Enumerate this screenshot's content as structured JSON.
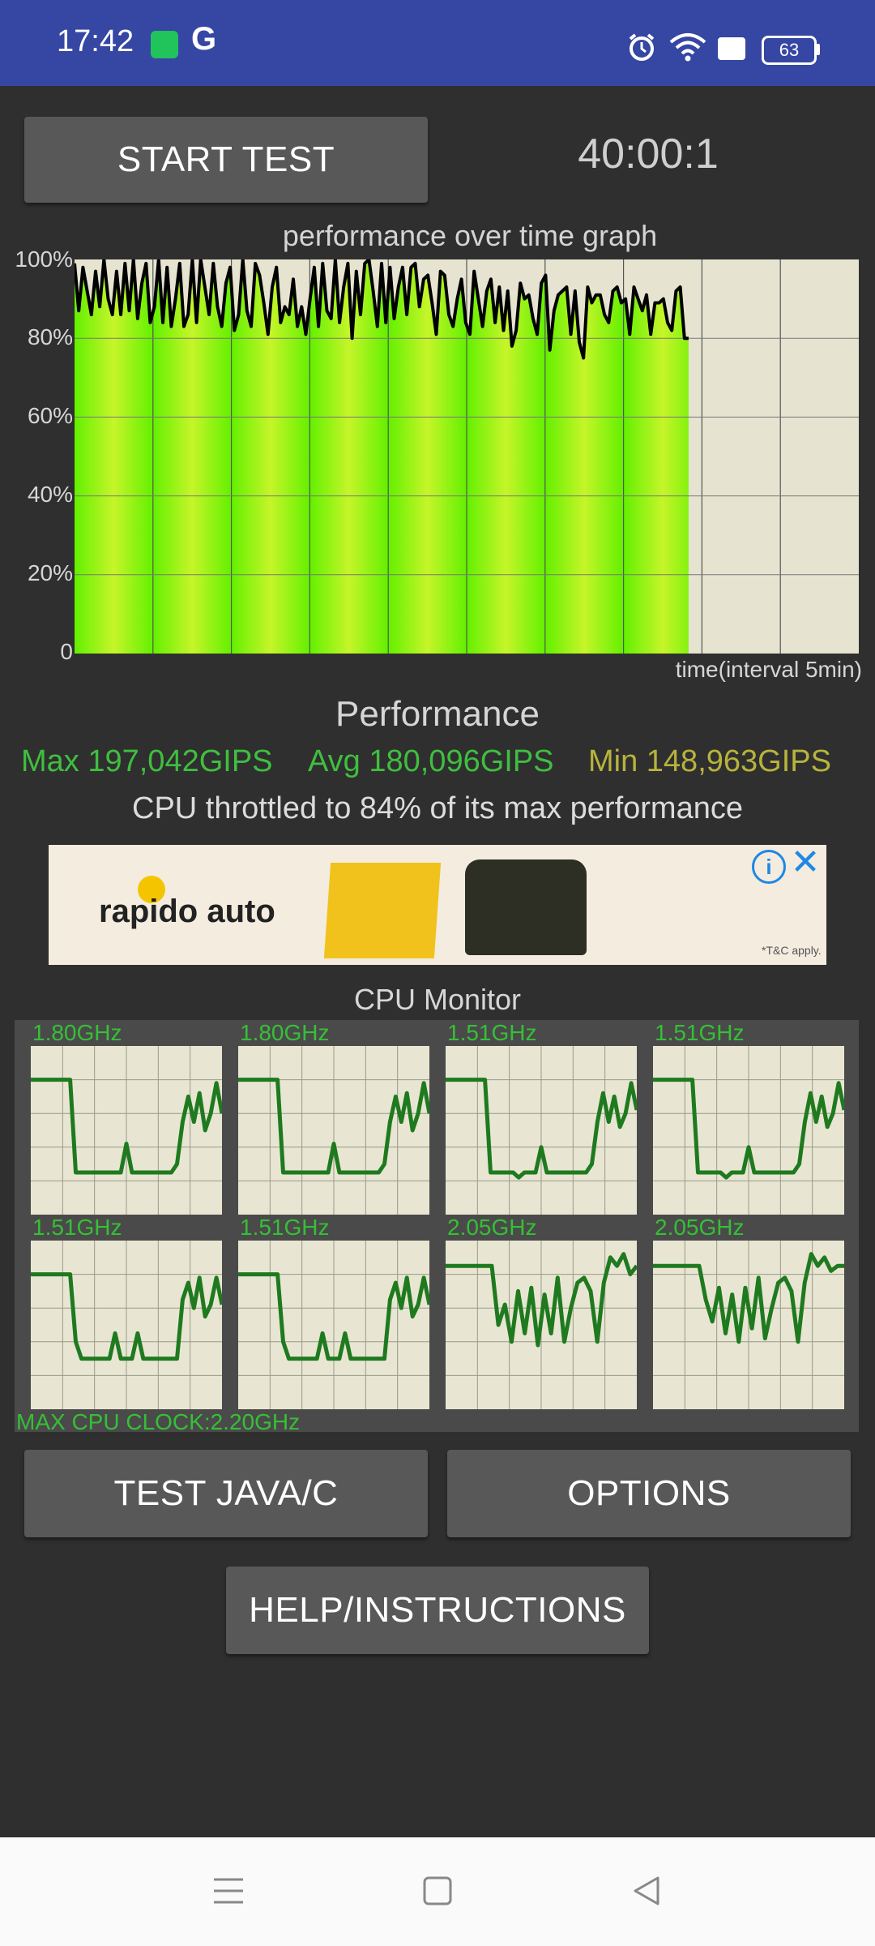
{
  "status": {
    "time": "17:42",
    "g_label": "G",
    "battery": "63"
  },
  "controls": {
    "start_label": "START TEST",
    "timer": "40:00:1"
  },
  "graph": {
    "title": "performance over time graph",
    "y_ticks": [
      "100%",
      "80%",
      "60%",
      "40%",
      "20%",
      "0"
    ],
    "xlabel": "time(interval 5min)"
  },
  "chart_data": {
    "type": "area",
    "title": "performance over time graph",
    "xlabel": "time(interval 5min)",
    "ylabel": "",
    "ylim": [
      0,
      100
    ],
    "values": [
      99,
      87,
      98,
      92,
      86,
      97,
      88,
      100,
      90,
      86,
      97,
      86,
      99,
      87,
      100,
      85,
      94,
      99,
      84,
      88,
      100,
      84,
      98,
      83,
      90,
      99,
      83,
      86,
      100,
      84,
      100,
      93,
      86,
      99,
      88,
      83,
      94,
      98,
      82,
      86,
      100,
      87,
      83,
      99,
      96,
      89,
      81,
      93,
      98,
      84,
      88,
      86,
      95,
      83,
      88,
      81,
      90,
      98,
      83,
      99,
      87,
      85,
      100,
      84,
      93,
      99,
      80,
      97,
      86,
      99,
      100,
      92,
      83,
      99,
      84,
      98,
      85,
      93,
      98,
      86,
      98,
      99,
      88,
      95,
      96,
      89,
      81,
      97,
      96,
      86,
      83,
      90,
      95,
      84,
      81,
      97,
      90,
      83,
      92,
      95,
      84,
      93,
      82,
      92,
      78,
      82,
      94,
      90,
      91,
      85,
      81,
      94,
      96,
      77,
      87,
      91,
      92,
      93,
      81,
      92,
      79,
      75,
      93,
      89,
      91,
      91,
      86,
      84,
      92,
      93,
      89,
      90,
      81,
      93,
      90,
      87,
      91,
      81,
      89,
      89,
      90,
      84,
      82,
      92,
      93,
      80,
      80
    ],
    "x_fraction_of_axis": 0.783
  },
  "performance": {
    "title": "Performance",
    "max": "Max 197,042GIPS",
    "avg": "Avg 180,096GIPS",
    "min": "Min 148,963GIPS",
    "throttle": "CPU throttled to 84% of its max performance"
  },
  "ad": {
    "brand": "rapido auto",
    "tc": "*T&C apply.",
    "info": "i",
    "close": "✕"
  },
  "cpu": {
    "title": "CPU Monitor",
    "cores": [
      {
        "freq": "1.80GHz",
        "values": [
          80,
          80,
          80,
          80,
          80,
          80,
          80,
          80,
          25,
          25,
          25,
          25,
          25,
          25,
          25,
          25,
          25,
          42,
          25,
          25,
          25,
          25,
          25,
          25,
          25,
          25,
          30,
          55,
          70,
          55,
          72,
          50,
          60,
          78,
          60
        ]
      },
      {
        "freq": "1.80GHz",
        "values": [
          80,
          80,
          80,
          80,
          80,
          80,
          80,
          80,
          25,
          25,
          25,
          25,
          25,
          25,
          25,
          25,
          25,
          42,
          25,
          25,
          25,
          25,
          25,
          25,
          25,
          25,
          30,
          55,
          70,
          55,
          72,
          50,
          60,
          78,
          60
        ]
      },
      {
        "freq": "1.51GHz",
        "values": [
          80,
          80,
          80,
          80,
          80,
          80,
          80,
          80,
          25,
          25,
          25,
          25,
          25,
          22,
          25,
          25,
          25,
          40,
          25,
          25,
          25,
          25,
          25,
          25,
          25,
          25,
          30,
          55,
          72,
          55,
          70,
          52,
          60,
          78,
          62
        ]
      },
      {
        "freq": "1.51GHz",
        "values": [
          80,
          80,
          80,
          80,
          80,
          80,
          80,
          80,
          25,
          25,
          25,
          25,
          25,
          22,
          25,
          25,
          25,
          40,
          25,
          25,
          25,
          25,
          25,
          25,
          25,
          25,
          30,
          55,
          72,
          55,
          70,
          52,
          60,
          78,
          62
        ]
      },
      {
        "freq": "1.51GHz",
        "values": [
          80,
          80,
          80,
          80,
          80,
          80,
          80,
          80,
          40,
          30,
          30,
          30,
          30,
          30,
          30,
          45,
          30,
          30,
          30,
          45,
          30,
          30,
          30,
          30,
          30,
          30,
          30,
          65,
          75,
          60,
          78,
          55,
          62,
          78,
          62
        ]
      },
      {
        "freq": "1.51GHz",
        "values": [
          80,
          80,
          80,
          80,
          80,
          80,
          80,
          80,
          40,
          30,
          30,
          30,
          30,
          30,
          30,
          45,
          30,
          30,
          30,
          45,
          30,
          30,
          30,
          30,
          30,
          30,
          30,
          65,
          75,
          60,
          78,
          55,
          62,
          78,
          62
        ]
      },
      {
        "freq": "2.05GHz",
        "values": [
          85,
          85,
          85,
          85,
          85,
          85,
          85,
          85,
          50,
          62,
          40,
          70,
          45,
          72,
          38,
          68,
          45,
          78,
          40,
          60,
          75,
          78,
          70,
          40,
          75,
          90,
          85,
          92,
          80,
          85
        ]
      },
      {
        "freq": "2.05GHz",
        "values": [
          85,
          85,
          85,
          85,
          85,
          85,
          85,
          85,
          65,
          52,
          72,
          45,
          68,
          40,
          72,
          48,
          78,
          42,
          60,
          75,
          78,
          70,
          40,
          75,
          92,
          85,
          90,
          82,
          85,
          85
        ]
      }
    ],
    "max_clock": "MAX CPU CLOCK:2.20GHz"
  },
  "buttons": {
    "java_label": "TEST JAVA/C",
    "options_label": "OPTIONS",
    "help_label": "HELP/INSTRUCTIONS"
  }
}
